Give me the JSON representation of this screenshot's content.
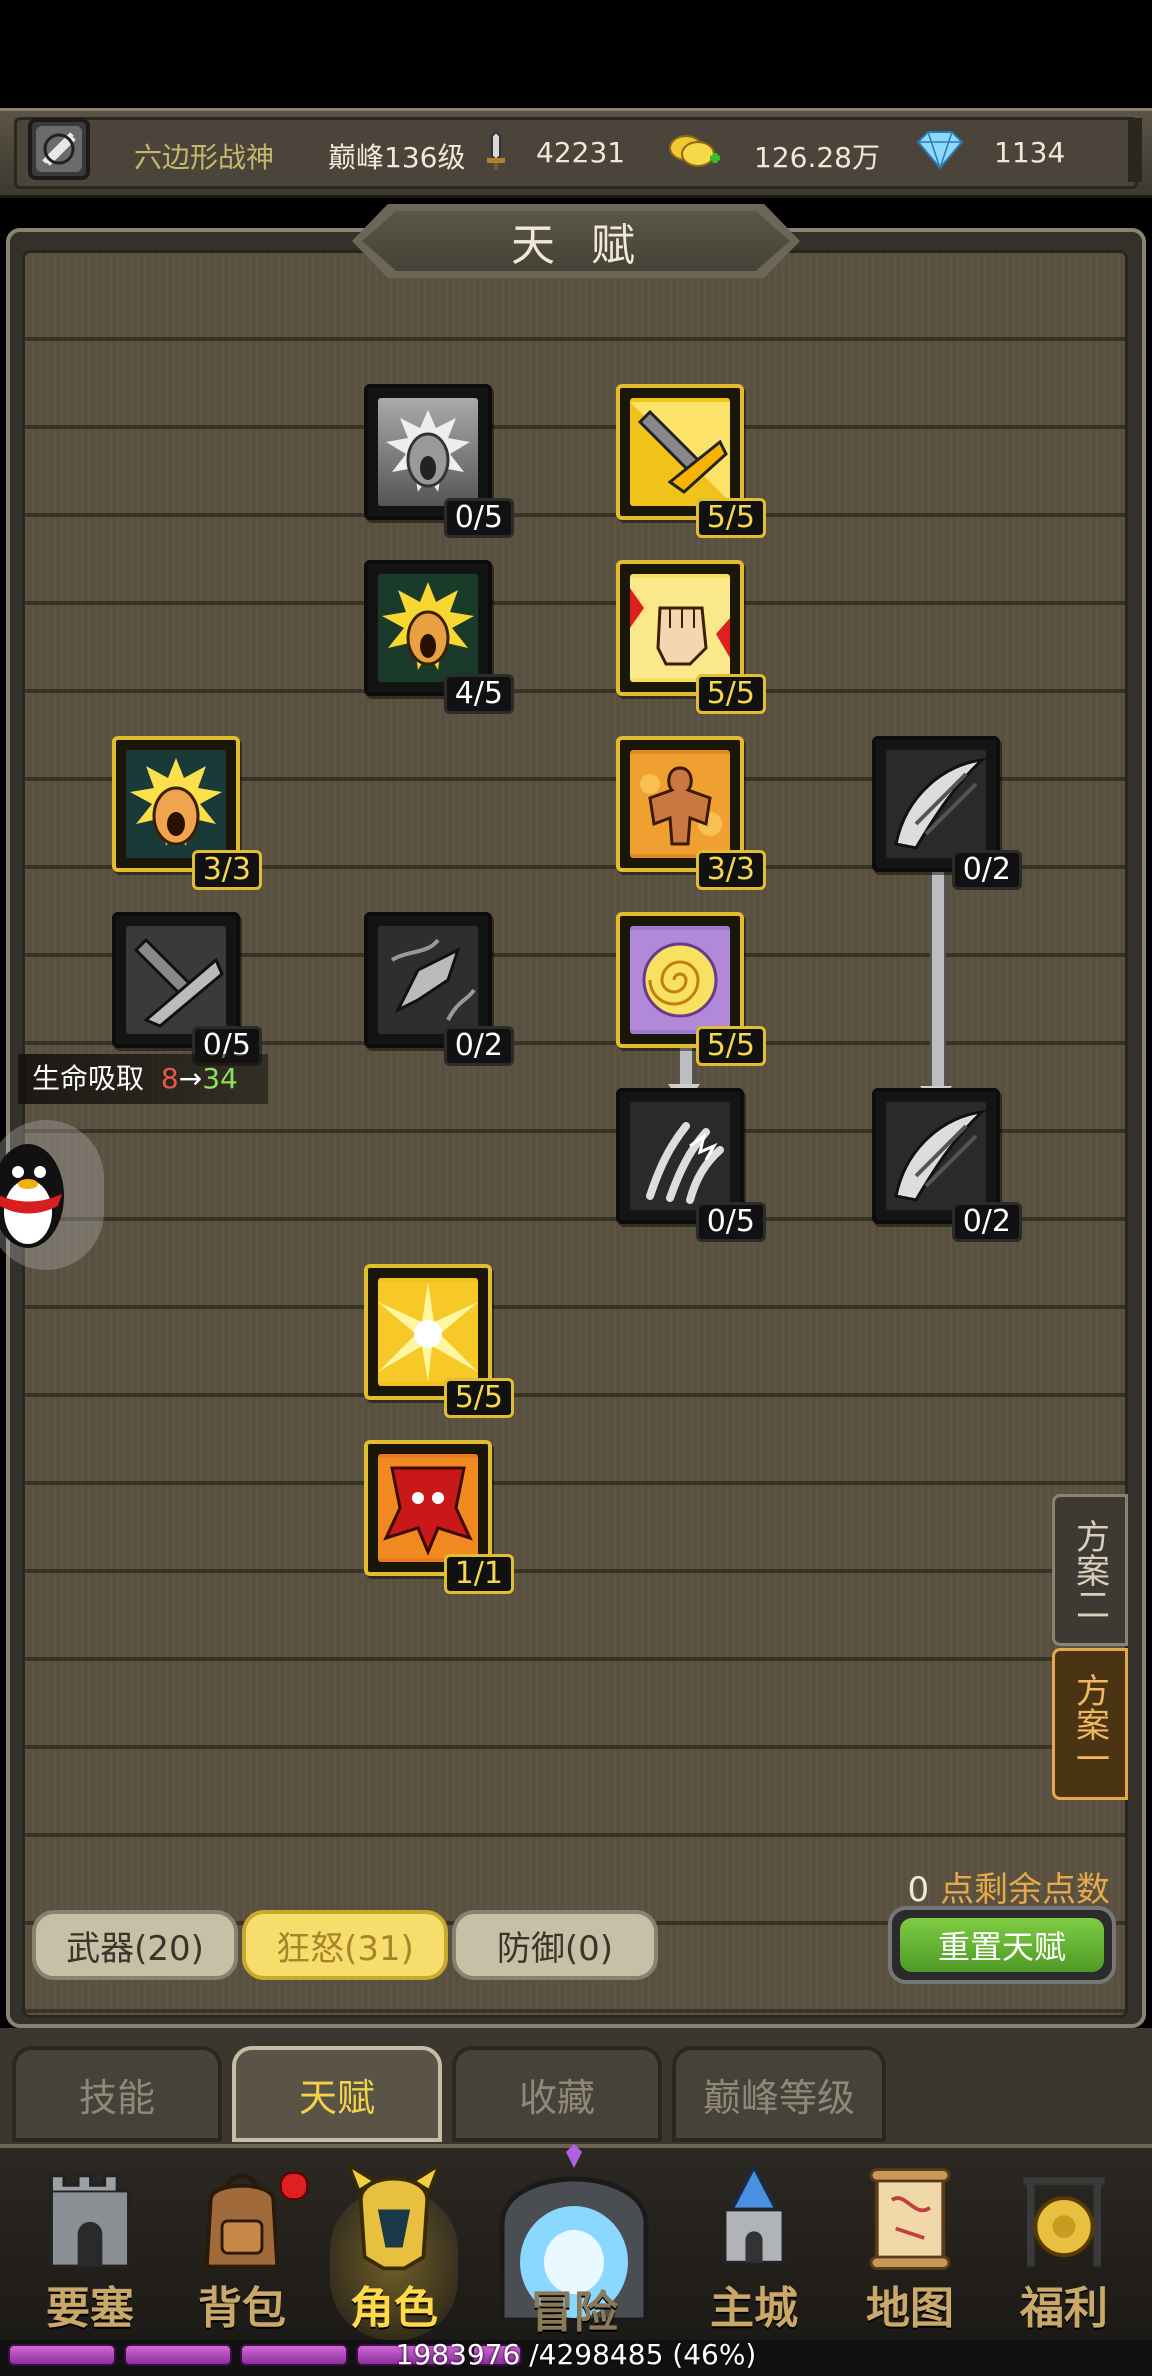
{
  "header": {
    "player_name": "六边形战神",
    "peak_level": "巅峰136级",
    "power": "42231",
    "gold": "126.28万",
    "diamonds": "1134"
  },
  "panel": {
    "title": "天赋"
  },
  "talents": [
    {
      "icon": "scream-gray-icon",
      "count": "0/5",
      "active": false
    },
    {
      "icon": "sword-strike-icon",
      "count": "5/5",
      "active": true
    },
    {
      "icon": "scream-gold-icon",
      "count": "4/5",
      "active": false
    },
    {
      "icon": "fist-punch-icon",
      "count": "5/5",
      "active": true
    },
    {
      "icon": "rage-scream-icon",
      "count": "3/3",
      "active": true
    },
    {
      "icon": "muscle-berserker-icon",
      "count": "3/3",
      "active": true
    },
    {
      "icon": "blade-slash-icon",
      "count": "0/2",
      "active": false
    },
    {
      "icon": "sword-gray-icon",
      "count": "0/5",
      "active": false
    },
    {
      "icon": "axe-whirl-icon",
      "count": "0/2",
      "active": false
    },
    {
      "icon": "vortex-icon",
      "count": "5/5",
      "active": true
    },
    {
      "icon": "claw-icon",
      "count": "0/5",
      "active": false
    },
    {
      "icon": "blade-slash-icon",
      "count": "0/2",
      "active": false
    },
    {
      "icon": "sunburst-icon",
      "count": "5/5",
      "active": true
    },
    {
      "icon": "war-banner-icon",
      "count": "1/1",
      "active": true
    }
  ],
  "tooltip": {
    "label": "生命吸取",
    "from": "8",
    "arrow": "→",
    "to": "34"
  },
  "plans": {
    "plan2": "方案二",
    "plan1": "方案一"
  },
  "points": {
    "value": "0",
    "label": "点剩余点数"
  },
  "categories": {
    "weapon": "武器(20)",
    "rage": "狂怒(31)",
    "defense": "防御(0)"
  },
  "reset_label": "重置天赋",
  "subtabs": [
    "技能",
    "天赋",
    "收藏",
    "巅峰等级"
  ],
  "nav": [
    "要塞",
    "背包",
    "角色",
    "冒险",
    "主城",
    "地图",
    "福利"
  ],
  "xp": {
    "text": "1983976 /4298485 (46%)",
    "fraction": 0.46
  },
  "colors": {
    "gold_border": "#e2be2e",
    "count_gold": "#f6d84a",
    "tooltip_from": "#e45a4a",
    "tooltip_to": "#8ee05a",
    "reset_green": "#5eb02e",
    "plan_active": "#e6a94a"
  }
}
